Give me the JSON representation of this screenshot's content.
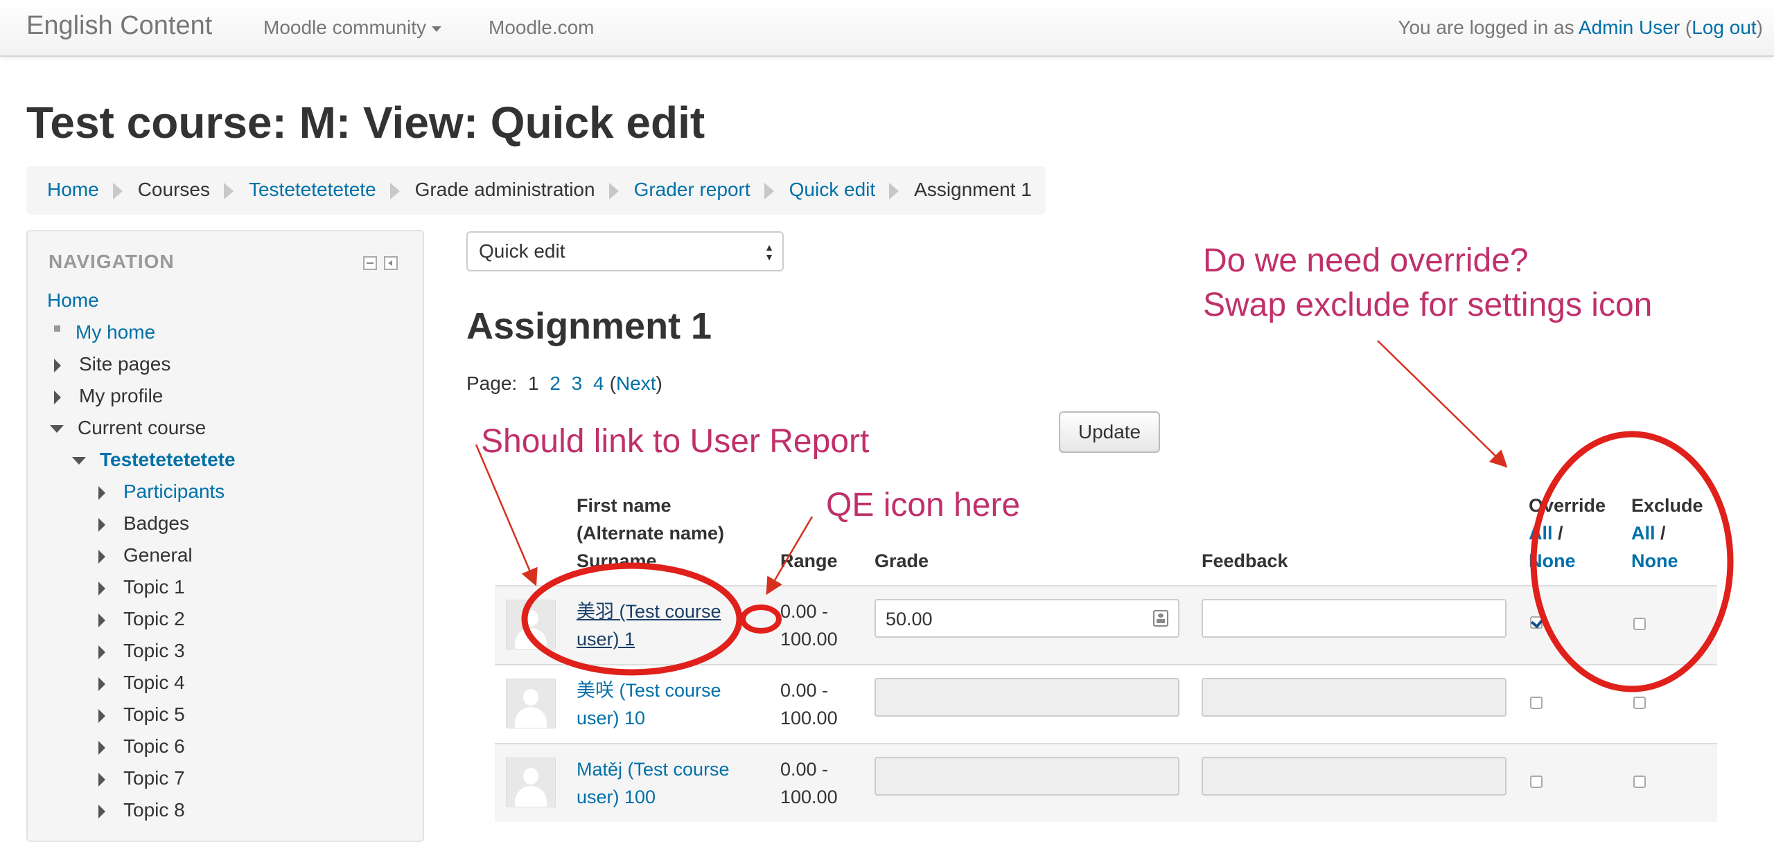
{
  "navbar": {
    "brand": "English Content",
    "menu_community": "Moodle community",
    "menu_moodle": "Moodle.com",
    "login_prefix": "You are logged in as ",
    "login_user": "Admin User",
    "login_paren_open": " (",
    "logout": "Log out",
    "login_paren_close": ")"
  },
  "page_title": "Test course: M: View: Quick edit",
  "breadcrumb": [
    "Home",
    "Courses",
    "Testetetetetete",
    "Grade administration",
    "Grader report",
    "Quick edit",
    "Assignment 1"
  ],
  "navigation": {
    "title": "NAVIGATION",
    "items": [
      "Home",
      "My home",
      "Site pages",
      "My profile",
      "Current course",
      "Testetetetetete",
      "Participants",
      "Badges",
      "General",
      "Topic 1",
      "Topic 2",
      "Topic 3",
      "Topic 4",
      "Topic 5",
      "Topic 6",
      "Topic 7",
      "Topic 8"
    ]
  },
  "view_select": {
    "value": "Quick edit"
  },
  "heading": "Assignment 1",
  "paging": {
    "label": "Page:",
    "pages": [
      "1",
      "2",
      "3",
      "4"
    ],
    "next_open": "(",
    "next": "Next",
    "next_close": ")"
  },
  "update_button": "Update",
  "table": {
    "headers": {
      "name_line1": "First name",
      "name_line2": "(Alternate name)",
      "name_line3": "Surname",
      "range": "Range",
      "grade": "Grade",
      "feedback": "Feedback",
      "override": "Override",
      "exclude": "Exclude",
      "all": "All",
      "slash": " /",
      "none": "None"
    },
    "rows": [
      {
        "name": "美羽 (Test course user) 1",
        "range_line1": "0.00 -",
        "range_line2": "100.00",
        "grade": "50.00",
        "feedback": "",
        "override": true,
        "exclude": false
      },
      {
        "name": "美咲 (Test course user) 10",
        "range_line1": "0.00 -",
        "range_line2": "100.00",
        "grade": "",
        "feedback": "",
        "override": false,
        "exclude": false
      },
      {
        "name": "Matěj (Test course user) 100",
        "range_line1": "0.00 -",
        "range_line2": "100.00",
        "grade": "",
        "feedback": "",
        "override": false,
        "exclude": false
      }
    ]
  },
  "annotations": {
    "override_line1": "Do we need override?",
    "override_line2": "Swap exclude for settings icon",
    "user_report": "Should link to User Report",
    "qe_icon": "QE icon here",
    "color": "#c0306a",
    "arrow_color": "#d7301f"
  },
  "colors": {
    "link": "#0070a8",
    "text": "#333333"
  }
}
